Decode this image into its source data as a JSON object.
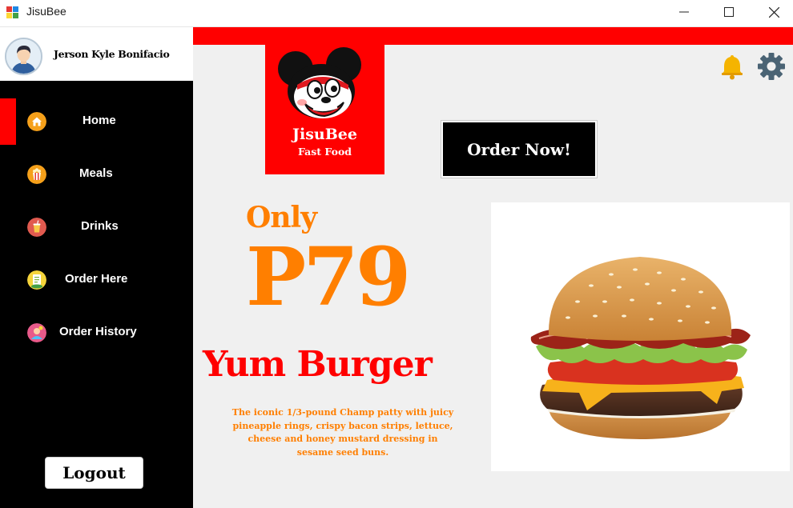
{
  "window": {
    "title": "JisuBee",
    "controls": [
      "minimize",
      "maximize",
      "close"
    ]
  },
  "sidebar": {
    "user_name": "Jerson Kyle Bonifacio",
    "active_item": "Home",
    "items": [
      {
        "label": "Home",
        "icon": "home-icon",
        "color": "#f5a01a"
      },
      {
        "label": "Meals",
        "icon": "meals-icon",
        "color": "#f5a01a"
      },
      {
        "label": "Drinks",
        "icon": "drinks-icon",
        "color": "#e05a4f"
      },
      {
        "label": "Order Here",
        "icon": "order-here-icon",
        "color": "#f5d43b"
      },
      {
        "label": "Order History",
        "icon": "order-history-icon",
        "color": "#e85a8a"
      }
    ],
    "logout_label": "Logout"
  },
  "header": {
    "logo_name": "JisuBee",
    "logo_subtitle": "Fast Food",
    "order_button_label": "Order Now!",
    "icons": [
      "bell-icon",
      "gear-icon"
    ]
  },
  "promo": {
    "prefix": "Only",
    "price": "P79",
    "product_name": "Yum Burger",
    "description": "The iconic 1/3-pound Champ patty with juicy pineapple rings, crispy bacon strips, lettuce, cheese and honey mustard dressing in sesame seed buns."
  },
  "colors": {
    "brand_red": "#ff0000",
    "accent_orange": "#ff7f00",
    "sidebar_bg": "#000000",
    "main_bg": "#f0f0f0",
    "bell": "#f5b400",
    "gear": "#4a6374"
  }
}
